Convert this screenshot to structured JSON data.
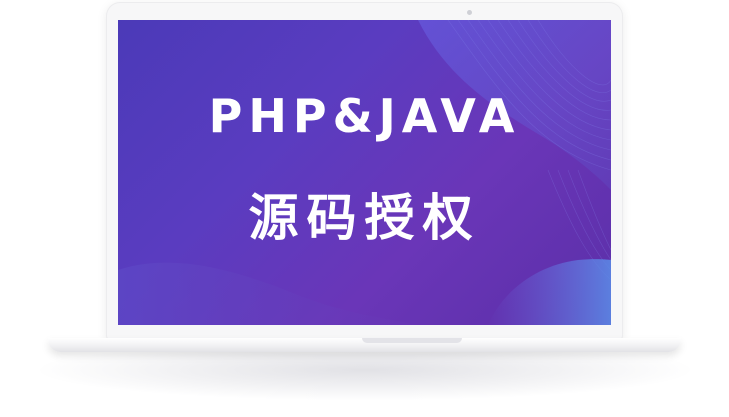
{
  "banner": {
    "headline": "PHP&JAVA",
    "subheadline": "源码授权"
  },
  "colors": {
    "screen_start": "#4b3ab8",
    "screen_end": "#5b2fa8",
    "accent_wave": "#5a6fe0",
    "text": "#ffffff"
  },
  "icons": {
    "device": "laptop-icon"
  }
}
